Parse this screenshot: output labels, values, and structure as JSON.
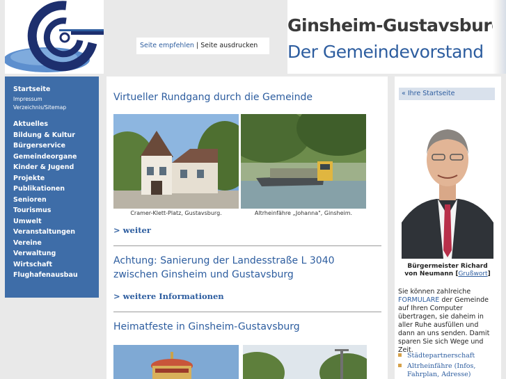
{
  "header": {
    "links": [
      "Seite empfehlen",
      "Seite ausdrucken"
    ],
    "separator": "|",
    "title_line1": "Ginsheim-Gustavsburg",
    "title_line2": "Der Gemeindevorstand"
  },
  "nav": {
    "top": [
      {
        "label": "Startseite",
        "small": false
      },
      {
        "label": "Impressum",
        "small": true
      },
      {
        "label": "Verzeichnis/Sitemap",
        "small": true
      }
    ],
    "main": [
      "Aktuelles",
      "Bildung & Kultur",
      "Bürgerservice",
      "Gemeindeorgane",
      "Kinder & Jugend",
      "Projekte",
      "Publikationen",
      "Senioren",
      "Tourismus",
      "Umwelt",
      "Veranstaltungen",
      "Vereine",
      "Verwaltung",
      "Wirtschaft",
      "Flughafenausbau"
    ]
  },
  "content": {
    "section1": {
      "title": "Virtueller Rundgang durch die Gemeinde",
      "captions": [
        "Cramer-Klett-Platz, Gustavsburg.",
        "Altrheinfähre „Johanna\", Ginsheim."
      ],
      "more": "> weiter"
    },
    "section2": {
      "title_line1": "Achtung: Sanierung der Landesstraße L 3040",
      "title_line2": "zwischen Ginsheim und Gustavsburg",
      "more": "> weitere Informationen"
    },
    "section3": {
      "title": "Heimatfeste in Ginsheim-Gustavsburg"
    }
  },
  "sidebar": {
    "home_link": "« Ihre Startseite",
    "mayor_name": "Bürgermeister Richard",
    "mayor_name2": "von Neumann",
    "greeting_link": "Grußwort",
    "info_pre": "Sie können zahlreiche",
    "info_link": "FORMULARE",
    "info_post": "der Gemeinde auf Ihren Computer übertragen, sie daheim in aller Ruhe ausfüllen und dann an uns senden. Damit sparen Sie sich Wege und Zeit.",
    "links": [
      "Städtepartnerschaft",
      "Altrheinfähre (Infos,",
      "Fahrplan, Adresse)"
    ]
  },
  "colors": {
    "accent": "#2d5d9f",
    "nav_bg": "#3e6da8",
    "bullet": "#d6a14a"
  }
}
